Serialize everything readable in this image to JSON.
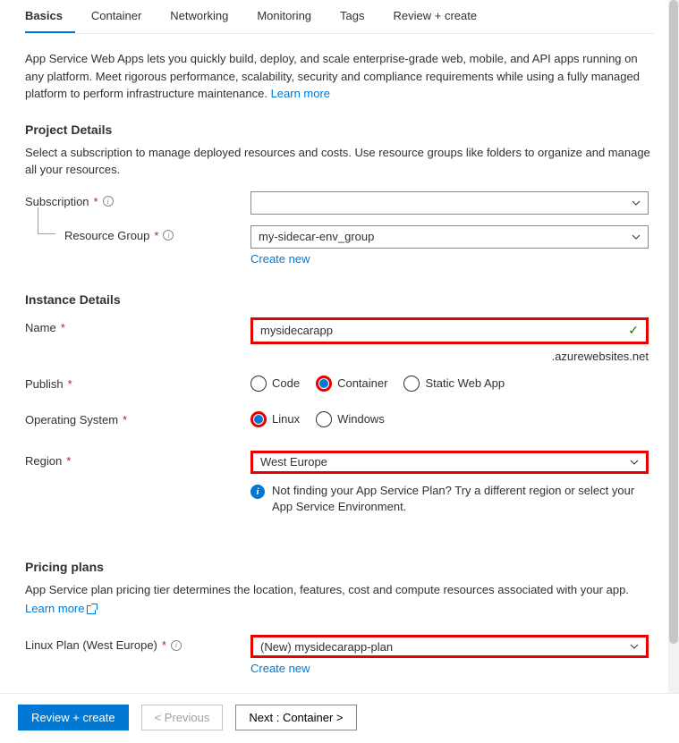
{
  "tabs": [
    {
      "label": "Basics",
      "active": true
    },
    {
      "label": "Container",
      "active": false
    },
    {
      "label": "Networking",
      "active": false
    },
    {
      "label": "Monitoring",
      "active": false
    },
    {
      "label": "Tags",
      "active": false
    },
    {
      "label": "Review + create",
      "active": false
    }
  ],
  "intro": {
    "text": "App Service Web Apps lets you quickly build, deploy, and scale enterprise-grade web, mobile, and API apps running on any platform. Meet rigorous performance, scalability, security and compliance requirements while using a fully managed platform to perform infrastructure maintenance.  ",
    "learn_more": "Learn more"
  },
  "project_details": {
    "title": "Project Details",
    "desc": "Select a subscription to manage deployed resources and costs. Use resource groups like folders to organize and manage all your resources.",
    "subscription": {
      "label": "Subscription",
      "value": ""
    },
    "resource_group": {
      "label": "Resource Group",
      "value": "my-sidecar-env_group",
      "create_new": "Create new"
    }
  },
  "instance_details": {
    "title": "Instance Details",
    "name": {
      "label": "Name",
      "value": "mysidecarapp",
      "suffix": ".azurewebsites.net"
    },
    "publish": {
      "label": "Publish",
      "options": [
        "Code",
        "Container",
        "Static Web App"
      ],
      "selected": "Container"
    },
    "os": {
      "label": "Operating System",
      "options": [
        "Linux",
        "Windows"
      ],
      "selected": "Linux"
    },
    "region": {
      "label": "Region",
      "value": "West Europe"
    },
    "info": "Not finding your App Service Plan? Try a different region or select your App Service Environment."
  },
  "pricing": {
    "title": "Pricing plans",
    "desc": "App Service plan pricing tier determines the location, features, cost and compute resources associated with your app.",
    "learn_more": "Learn more",
    "plan": {
      "label": "Linux Plan (West Europe)",
      "value": "(New) mysidecarapp-plan",
      "create_new": "Create new"
    }
  },
  "footer": {
    "review": "Review + create",
    "previous": "< Previous",
    "next": "Next : Container >"
  }
}
